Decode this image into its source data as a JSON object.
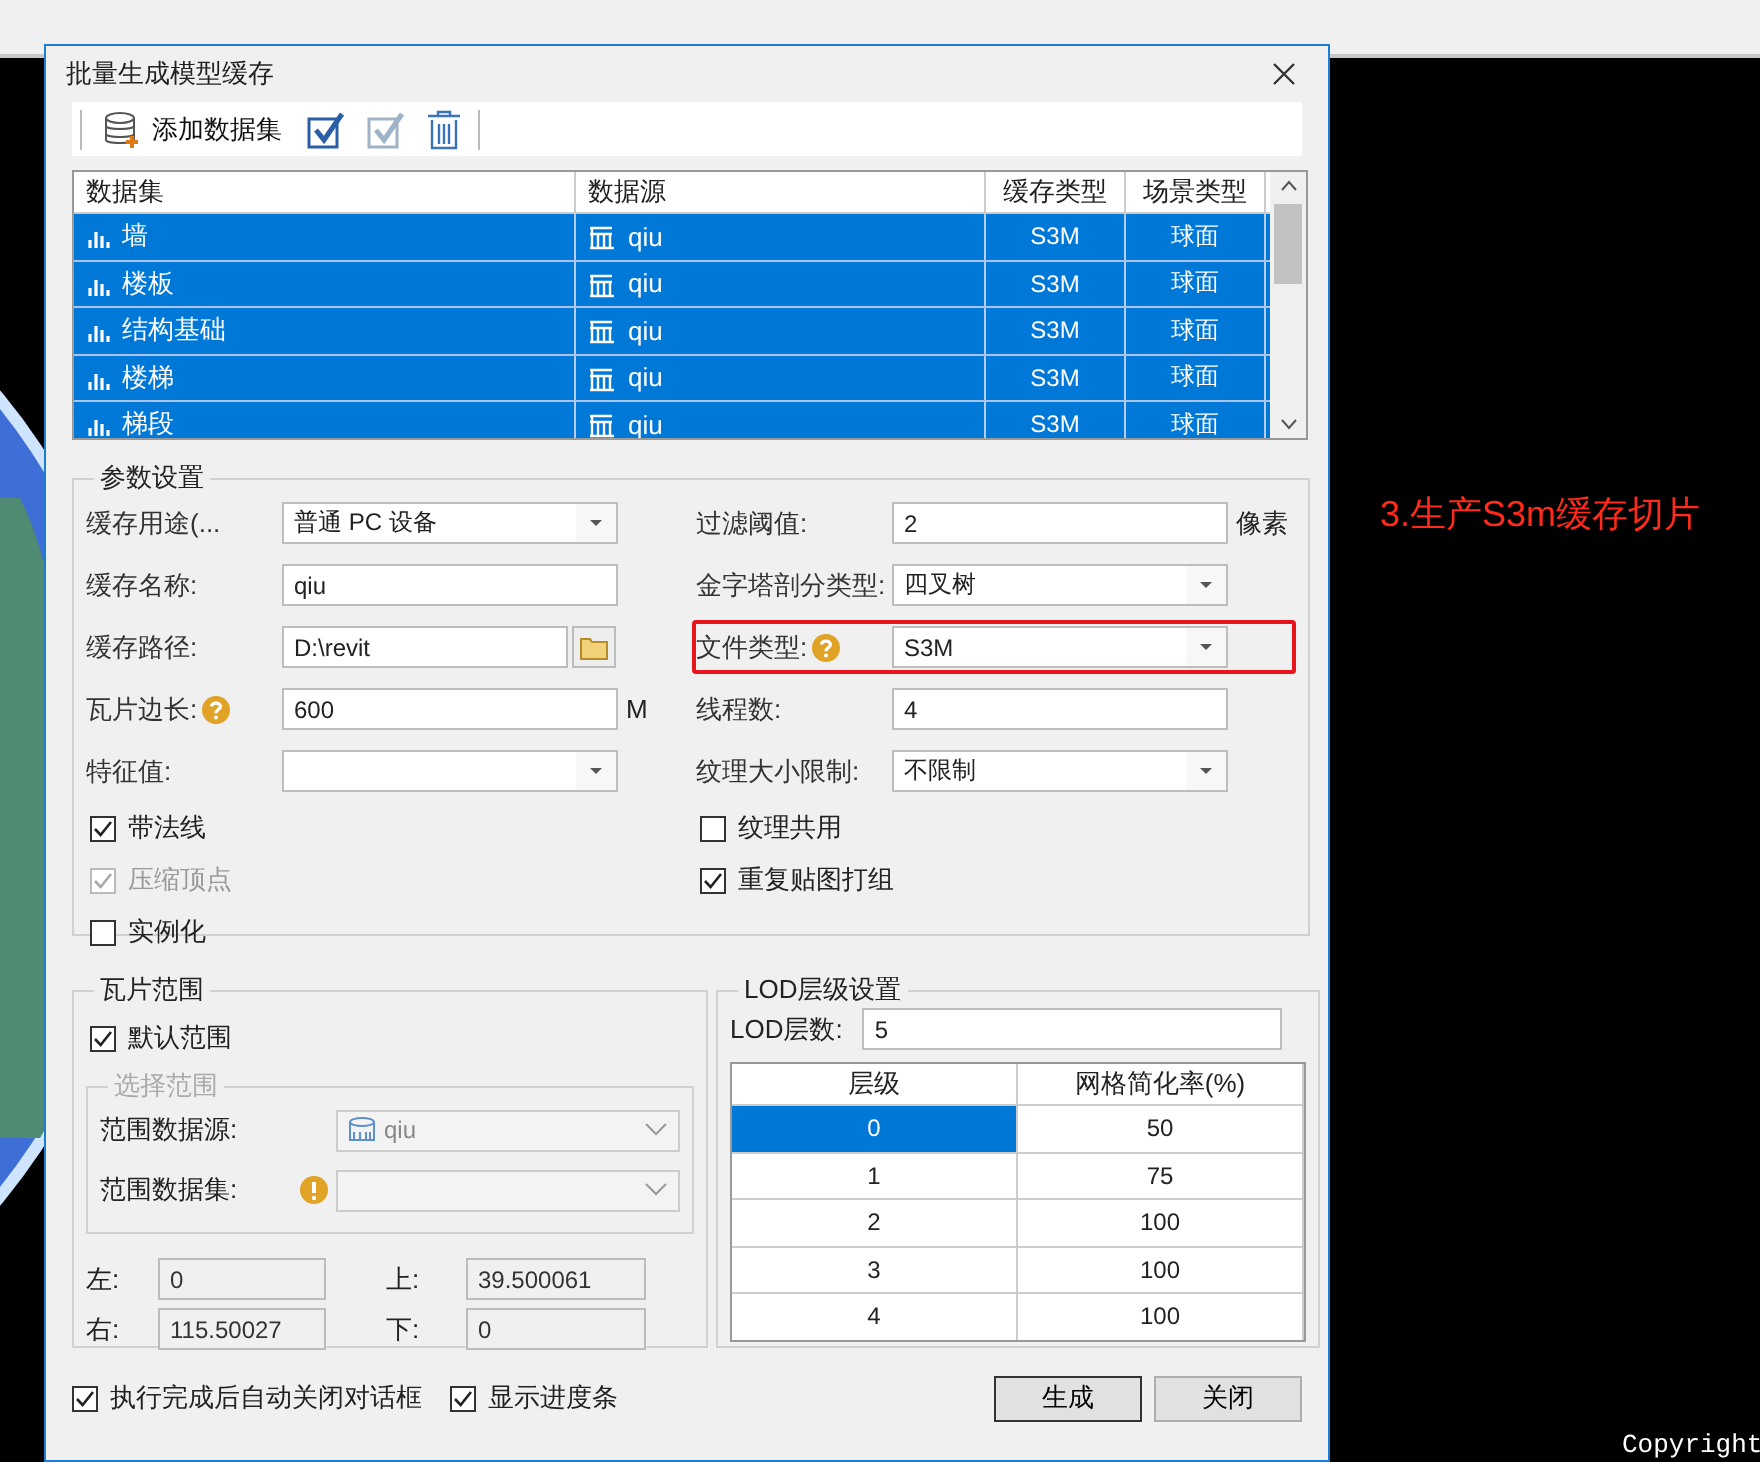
{
  "dialog": {
    "title": "批量生成模型缓存"
  },
  "toolbar": {
    "add_label": "添加数据集"
  },
  "datasets": {
    "columns": [
      "数据集",
      "数据源",
      "缓存类型",
      "场景类型"
    ],
    "rows": [
      {
        "dataset": "墙",
        "source": "qiu",
        "cache_type": "S3M",
        "scene_type": "球面",
        "selected": true
      },
      {
        "dataset": "楼板",
        "source": "qiu",
        "cache_type": "S3M",
        "scene_type": "球面",
        "selected": true
      },
      {
        "dataset": "结构基础",
        "source": "qiu",
        "cache_type": "S3M",
        "scene_type": "球面",
        "selected": true
      },
      {
        "dataset": "楼梯",
        "source": "qiu",
        "cache_type": "S3M",
        "scene_type": "球面",
        "selected": true
      },
      {
        "dataset": "梯段",
        "source": "qiu",
        "cache_type": "S3M",
        "scene_type": "球面",
        "selected": true
      }
    ]
  },
  "params": {
    "title": "参数设置",
    "left_fields": [
      {
        "kind": "dropdown",
        "label": "缓存用途(...",
        "value": "普通 PC 设备",
        "help": false,
        "highlighted": false
      },
      {
        "kind": "text",
        "label": "缓存名称:",
        "value": "qiu",
        "help": false,
        "highlighted": false
      },
      {
        "kind": "path",
        "label": "缓存路径:",
        "value": "D:\\revit",
        "help": false,
        "highlighted": false
      },
      {
        "kind": "text",
        "label": "瓦片边长:",
        "value": "600",
        "unit": "M",
        "help": true,
        "highlighted": false
      },
      {
        "kind": "dropdown",
        "label": "特征值:",
        "help": false,
        "highlighted": false
      }
    ],
    "right_fields": [
      {
        "kind": "text",
        "label": "过滤阈值:",
        "value": "2",
        "unit": "像素",
        "help": false,
        "highlighted": false
      },
      {
        "kind": "dropdown",
        "label": "金字塔剖分类型:",
        "value": "四叉树",
        "help": false,
        "highlighted": false
      },
      {
        "kind": "dropdown",
        "label": "文件类型:",
        "value": "S3M",
        "help": true,
        "highlighted": true
      },
      {
        "kind": "text",
        "label": "线程数:",
        "value": "4",
        "help": false,
        "highlighted": false
      },
      {
        "kind": "dropdown",
        "label": "纹理大小限制:",
        "value": "不限制",
        "help": false,
        "highlighted": false
      }
    ],
    "left_options": [
      {
        "label": "带法线",
        "checked": true,
        "disabled": false
      },
      {
        "label": "压缩顶点",
        "checked": true,
        "disabled": true
      },
      {
        "label": "实例化",
        "checked": false,
        "disabled": false
      }
    ],
    "right_options": [
      {
        "label": "纹理共用",
        "checked": false,
        "disabled": false
      },
      {
        "label": "重复贴图打组",
        "checked": true,
        "disabled": false
      }
    ]
  },
  "tile_range": {
    "title": "瓦片范围",
    "default_range": {
      "label": "默认范围",
      "checked": true,
      "disabled": false
    },
    "select_group": {
      "title": "选择范围",
      "disabled": true,
      "source": {
        "label": "范围数据源:",
        "value": "qiu"
      },
      "dataset": {
        "label": "范围数据集:"
      }
    },
    "bounds": [
      {
        "label": "左:",
        "value": "0"
      },
      {
        "label": "上:",
        "value": "39.500061"
      },
      {
        "label": "右:",
        "value": "115.50027"
      },
      {
        "label": "下:",
        "value": "0"
      }
    ]
  },
  "lod": {
    "title": "LOD层级设置",
    "count_label": "LOD层数:",
    "count": "5",
    "columns": [
      "层级",
      "网格简化率(%)"
    ],
    "rows": [
      {
        "level": "0",
        "rate": "50",
        "selected": true
      },
      {
        "level": "1",
        "rate": "75",
        "selected": false
      },
      {
        "level": "2",
        "rate": "100",
        "selected": false
      },
      {
        "level": "3",
        "rate": "100",
        "selected": false
      },
      {
        "level": "4",
        "rate": "100",
        "selected": false
      }
    ]
  },
  "footer": {
    "options": [
      {
        "label": "执行完成后自动关闭对话框",
        "checked": true,
        "disabled": false
      },
      {
        "label": "显示进度条",
        "checked": true,
        "disabled": false
      }
    ],
    "buttons": [
      "生成",
      "关闭"
    ]
  },
  "annotation": "3.生产S3m缓存切片",
  "scene_copyright": "Copyright"
}
